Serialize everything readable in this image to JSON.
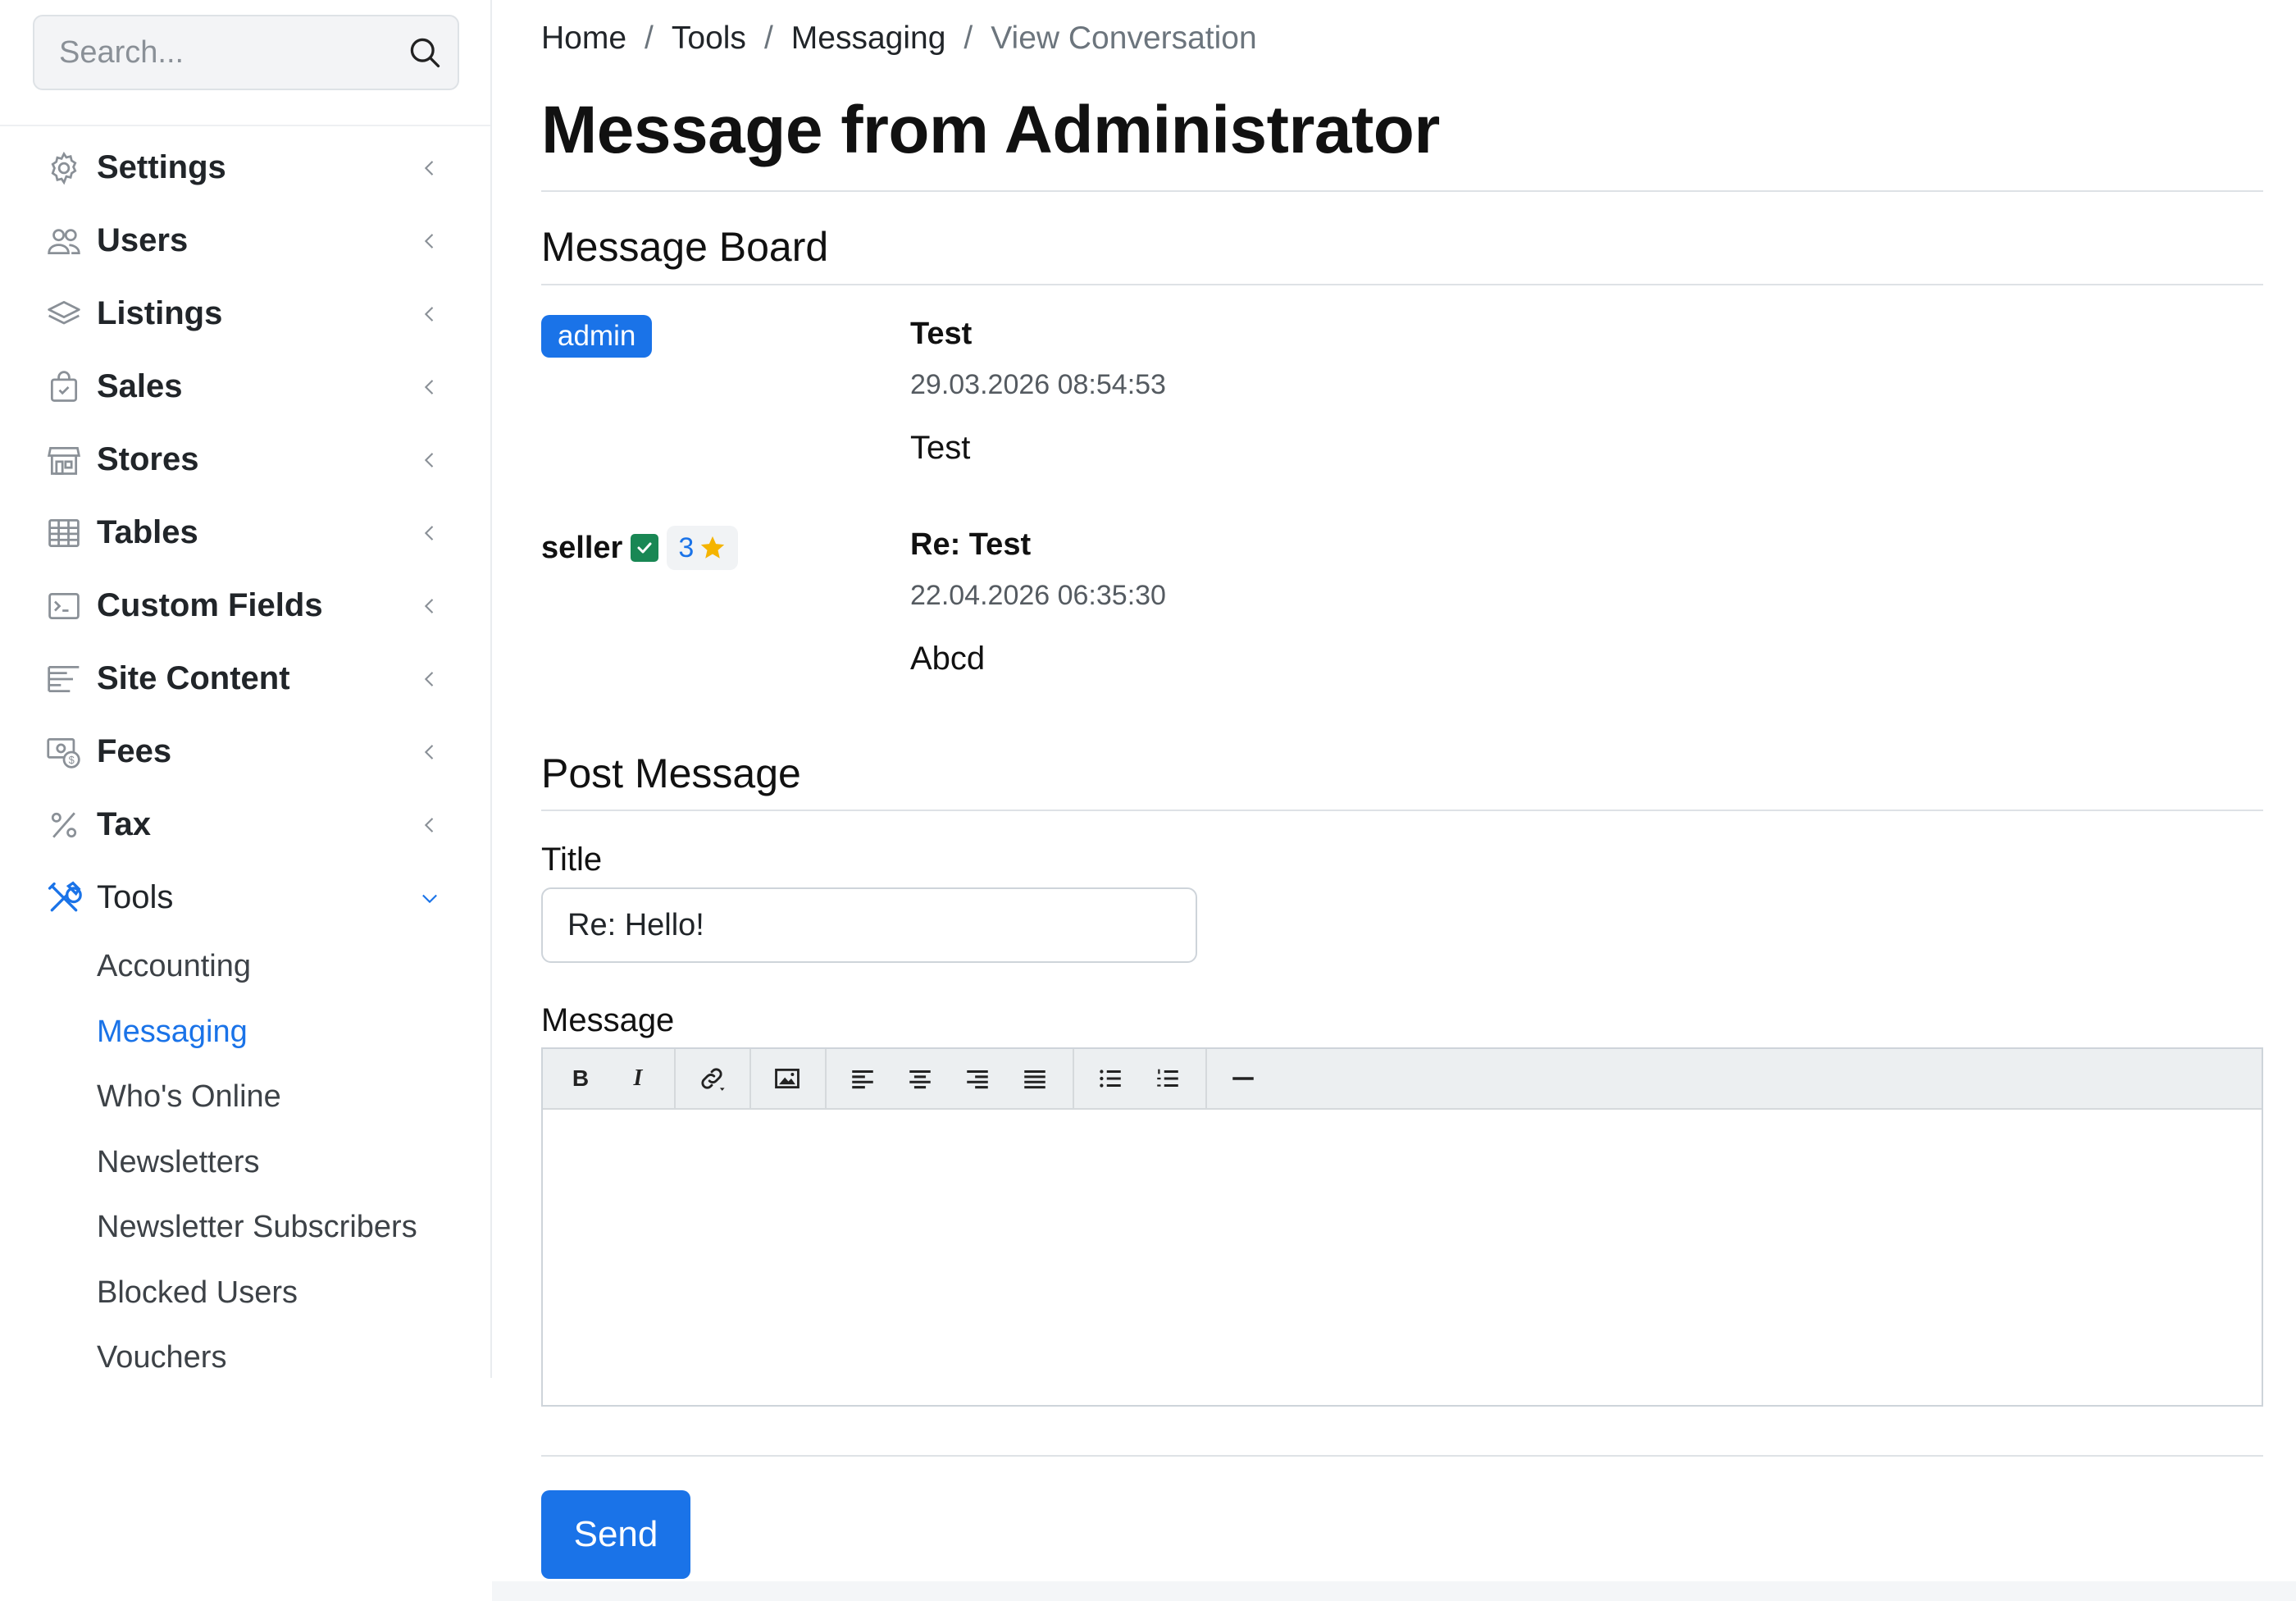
{
  "search": {
    "placeholder": "Search..."
  },
  "sidebar": {
    "items": [
      {
        "label": "Settings",
        "icon": "gear-icon"
      },
      {
        "label": "Users",
        "icon": "users-icon"
      },
      {
        "label": "Listings",
        "icon": "layers-icon"
      },
      {
        "label": "Sales",
        "icon": "shopping-bag-icon"
      },
      {
        "label": "Stores",
        "icon": "store-icon"
      },
      {
        "label": "Tables",
        "icon": "table-icon"
      },
      {
        "label": "Custom Fields",
        "icon": "terminal-icon"
      },
      {
        "label": "Site Content",
        "icon": "text-lines-icon"
      },
      {
        "label": "Fees",
        "icon": "money-icon"
      },
      {
        "label": "Tax",
        "icon": "percent-icon"
      },
      {
        "label": "Tools",
        "icon": "tools-icon"
      }
    ],
    "tools_subitems": [
      {
        "label": "Accounting"
      },
      {
        "label": "Messaging"
      },
      {
        "label": "Who's Online"
      },
      {
        "label": "Newsletters"
      },
      {
        "label": "Newsletter Subscribers"
      },
      {
        "label": "Blocked Users"
      },
      {
        "label": "Vouchers"
      }
    ],
    "active_subitem": "Messaging"
  },
  "breadcrumb": {
    "items": [
      "Home",
      "Tools",
      "Messaging"
    ],
    "separator": "/",
    "current": "View Conversation"
  },
  "page_title": "Message from Administrator",
  "message_board": {
    "heading": "Message Board",
    "messages": [
      {
        "sender_badge": "admin",
        "title": "Test",
        "date": "29.03.2026 08:54:53",
        "body": "Test"
      },
      {
        "sender": "seller",
        "rating": "3",
        "title": "Re: Test",
        "date": "22.04.2026 06:35:30",
        "body": "Abcd"
      }
    ]
  },
  "post_message": {
    "heading": "Post Message",
    "title_label": "Title",
    "title_value": "Re: Hello!",
    "message_label": "Message",
    "toolbar": {
      "bold": "B",
      "italic": "I"
    },
    "send_label": "Send"
  },
  "colors": {
    "accent": "#1a73e8",
    "verified": "#198754",
    "star": "#f5b400"
  }
}
